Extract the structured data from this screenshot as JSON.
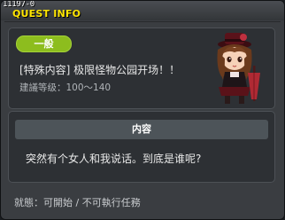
{
  "window": {
    "id": "11197-0",
    "title": "QUEST INFO"
  },
  "quest": {
    "category": "一般",
    "name": "[特殊内容] 极限怪物公园开场！！",
    "level_text": "建議等级：100～140"
  },
  "content": {
    "header": "内容",
    "text": "突然有个女人和我说话。到底是谁呢?"
  },
  "status": {
    "text": "就態：可開始 / 不可執行任務"
  },
  "colors": {
    "title": "#ffe600",
    "badge": "#8dbd1e"
  },
  "icons": {
    "npc": "npc-girl-portrait"
  }
}
